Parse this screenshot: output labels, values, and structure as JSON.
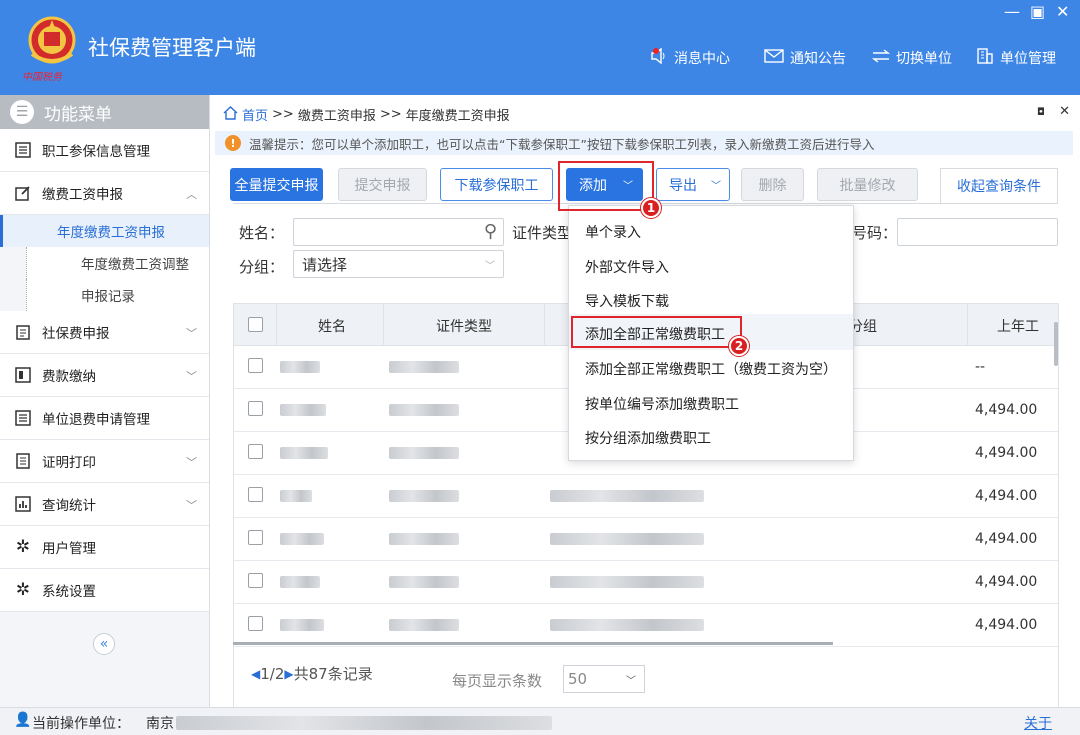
{
  "app": {
    "title": "社保费管理客户端",
    "logo_text": "中国税务"
  },
  "header_nav": [
    {
      "label": "消息中心",
      "icon": "speaker-icon"
    },
    {
      "label": "通知公告",
      "icon": "envelope-icon"
    },
    {
      "label": "切换单位",
      "icon": "switch-arrows-icon"
    },
    {
      "label": "单位管理",
      "icon": "building-icon"
    }
  ],
  "window_controls": {
    "minimize": "—",
    "maximize": "▣",
    "close": "✕"
  },
  "sidebar": {
    "header": "功能菜单",
    "items": [
      {
        "label": "职工参保信息管理"
      },
      {
        "label": "缴费工资申报",
        "expanded": true
      },
      {
        "label": "社保费申报"
      },
      {
        "label": "费款缴纳"
      },
      {
        "label": "单位退费申请管理"
      },
      {
        "label": "证明打印"
      },
      {
        "label": "查询统计"
      },
      {
        "label": "用户管理"
      },
      {
        "label": "系统设置"
      }
    ],
    "sub_items": [
      {
        "label": "年度缴费工资申报",
        "active": true
      },
      {
        "label": "年度缴费工资调整"
      },
      {
        "label": "申报记录"
      }
    ],
    "collapse": "«"
  },
  "breadcrumb": {
    "home": "首页",
    "sep": ">>",
    "level1": "缴费工资申报",
    "level2": "年度缴费工资申报"
  },
  "panel_controls": {
    "restore": "◘",
    "close": "✕"
  },
  "notice": "温馨提示：您可以单个添加职工，也可以点击“下载参保职工”按钮下载参保职工列表，录入新缴费工资后进行导入",
  "toolbar": {
    "submit_all": "全量提交申报",
    "submit": "提交申报",
    "download": "下载参保职工",
    "add": "添加",
    "export": "导出",
    "delete": "删除",
    "batch_edit": "批量修改",
    "collapse_query": "收起查询条件"
  },
  "query": {
    "name_label": "姓名：",
    "id_type_label": "证件类型",
    "number_label": "号码：",
    "group_label": "分组：",
    "group_value": "请选择"
  },
  "table": {
    "headers": [
      "姓名",
      "证件类型",
      "分组",
      "上年工"
    ],
    "rows": [
      "--",
      "4,494.00",
      "4,494.00",
      "4,494.00",
      "4,494.00",
      "4,494.00",
      "4,494.00"
    ]
  },
  "pager": {
    "page": "1/2",
    "total": "共87条记录",
    "per_page_label": "每页显示条数",
    "per_page": "50"
  },
  "dropdown": {
    "items": [
      "单个录入",
      "外部文件导入",
      "导入模板下载",
      "添加全部正常缴费职工",
      "添加全部正常缴费职工（缴费工资为空）",
      "按单位编号添加缴费职工",
      "按分组添加缴费职工"
    ],
    "highlighted_index": 3
  },
  "badges": [
    "1",
    "2"
  ],
  "statusbar": {
    "label": "当前操作单位：",
    "unit": "南京",
    "about": "关于"
  },
  "colors": {
    "header": "#3d86e6",
    "primary": "#2a74e2",
    "highlight": "#e0262b"
  }
}
